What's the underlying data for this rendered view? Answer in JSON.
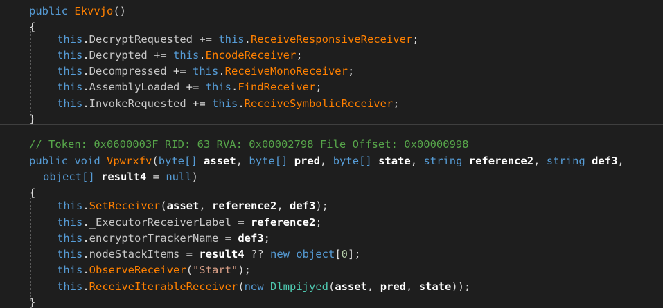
{
  "code": {
    "ctor": {
      "modifier": "public",
      "name": "Ekvvjo",
      "open_brace": "{",
      "close_brace": "}",
      "this_kw": "this",
      "lines": [
        {
          "event": "DecryptRequested",
          "handler": "ReceiveResponsiveReceiver"
        },
        {
          "event": "Decrypted",
          "handler": "EncodeReceiver"
        },
        {
          "event": "Decompressed",
          "handler": "ReceiveMonoReceiver"
        },
        {
          "event": "AssemblyLoaded",
          "handler": "FindReceiver"
        },
        {
          "event": "InvokeRequested",
          "handler": "ReceiveSymbolicReceiver"
        }
      ]
    },
    "method": {
      "comment": "// Token: 0x0600003F RID: 63 RVA: 0x00002798 File Offset: 0x00000998",
      "modifier": "public",
      "return_type": "void",
      "name": "Vpwrxfv",
      "params": [
        {
          "type": "byte[]",
          "name": "asset"
        },
        {
          "type": "byte[]",
          "name": "pred"
        },
        {
          "type": "byte[]",
          "name": "state"
        },
        {
          "type": "string",
          "name": "reference2"
        },
        {
          "type": "string",
          "name": "def3"
        },
        {
          "type": "object[]",
          "name": "result4",
          "default": "null"
        }
      ],
      "open_brace": "{",
      "close_brace": "}",
      "body": {
        "set_receiver": "SetReceiver",
        "set_receiver_args": [
          "asset",
          "reference2",
          "def3"
        ],
        "label_field": "_ExecutorReceiverLabel",
        "label_value": "reference2",
        "tracker_field": "encryptorTrackerName",
        "tracker_value": "def3",
        "stack_field": "nodeStackItems",
        "stack_value": "result4",
        "stack_fallback_kw": "new",
        "stack_fallback_type": "object",
        "stack_fallback_size": "0",
        "observe_method": "ObserveReceiver",
        "observe_arg": "\"Start\"",
        "iterable_method": "ReceiveIterableReceiver",
        "iterable_new_kw": "new",
        "iterable_type": "Dlmpijyed",
        "iterable_args": [
          "asset",
          "pred",
          "state"
        ]
      }
    }
  }
}
